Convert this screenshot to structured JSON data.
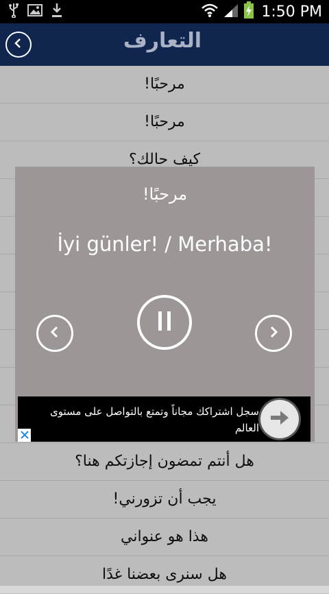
{
  "status_bar": {
    "time": "1:50 PM",
    "icons": [
      "usb-icon",
      "image-icon",
      "download-icon",
      "wifi-icon",
      "signal-icon",
      "battery-charging-icon"
    ]
  },
  "header": {
    "title": "التعارف",
    "back_icon": "chevron-left-circle-icon",
    "background": "#11264f"
  },
  "list": {
    "items": [
      "مرحبًا!",
      "مرحبًا!",
      "كيف حالك؟",
      "",
      "",
      "",
      "",
      "",
      "",
      "",
      "هل أنتم تمضون إجازتكم هنا؟",
      "يجب أن تزورني!",
      "هذا هو عنواني",
      "هل سنرى بعضنا غدًا"
    ]
  },
  "dialog": {
    "arabic": "مرحبًا!",
    "translation": "İyi günler! / Merhaba!",
    "prev_icon": "chevron-left-icon",
    "pause_icon": "pause-icon",
    "next_icon": "chevron-right-icon",
    "background": "#9c9696"
  },
  "ad": {
    "text": "سجل اشتراكك مجاناً وتمتع بالتواصل على مستوى العالم",
    "arrow_icon": "arrow-right-icon",
    "close_icon": "close-icon"
  }
}
